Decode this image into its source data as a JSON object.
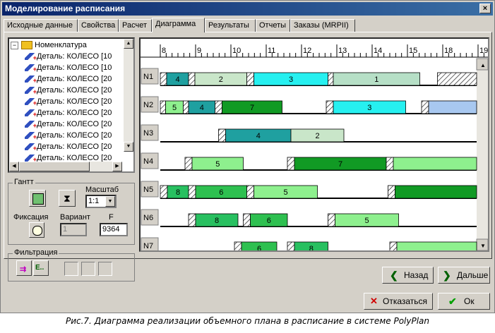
{
  "window": {
    "title": "Моделирование расписания",
    "close": "×"
  },
  "tabs": [
    {
      "label": "Исходные данные"
    },
    {
      "label": "Свойства"
    },
    {
      "label": "Расчет"
    },
    {
      "label": "Диаграмма"
    },
    {
      "label": "Результаты"
    },
    {
      "label": "Отчеты"
    },
    {
      "label": "Заказы (MRPII)"
    }
  ],
  "tree": {
    "root": "Номенклатура",
    "items": [
      "Деталь: КОЛЕСО [10",
      "Деталь: КОЛЕСО [10",
      "Деталь: КОЛЕСО [20",
      "Деталь: КОЛЕСО [20",
      "Деталь: КОЛЕСО [20",
      "Деталь: КОЛЕСО [20",
      "Деталь: КОЛЕСО [20",
      "Деталь: КОЛЕСО [20",
      "Деталь: КОЛЕСО [20",
      "Деталь: КОЛЕСО [20"
    ]
  },
  "gantt_group": {
    "title": "Гантт",
    "scale_label": "Масштаб",
    "scale_value": "1:1",
    "fix_label": "Фиксация",
    "variant_label": "Вариант",
    "variant_value": "1",
    "f_label": "F",
    "f_value": "9364"
  },
  "filter_group": {
    "title": "Фильтрация",
    "btn2_text": "E.."
  },
  "buttons": {
    "back": "Назад",
    "next": "Дальше",
    "cancel": "Отказаться",
    "ok": "Ок"
  },
  "caption": "Рис.7. Диаграмма реализации объемного плана в расписание в системе PolyPlan",
  "colors": {
    "c1": "#b6dfc6",
    "c2": "#c9e6c9",
    "c3": "#26f0f0",
    "c4": "#1fa0a0",
    "c5": "#8ef08e",
    "c6": "#2ec050",
    "c7": "#119a24",
    "c8": "#28c060",
    "blue": "#a8c8f0"
  },
  "chart_data": {
    "type": "gantt",
    "x_axis": {
      "ticks": [
        "8",
        "9",
        "10",
        "11",
        "12",
        "13",
        "14",
        "15",
        "18",
        "19"
      ]
    },
    "rows": [
      {
        "name": "N1",
        "bars": [
          {
            "start": 8.0,
            "end": 8.18,
            "label": "",
            "hatch": true
          },
          {
            "start": 8.18,
            "end": 8.8,
            "label": "4",
            "color": "c4"
          },
          {
            "start": 8.8,
            "end": 8.98,
            "label": "",
            "hatch": true
          },
          {
            "start": 8.98,
            "end": 10.45,
            "label": "2",
            "color": "c2"
          },
          {
            "start": 10.45,
            "end": 10.65,
            "label": "",
            "hatch": true
          },
          {
            "start": 10.65,
            "end": 12.75,
            "label": "3",
            "color": "c3"
          },
          {
            "start": 12.75,
            "end": 12.9,
            "label": "",
            "hatch": true
          },
          {
            "start": 12.9,
            "end": 15.35,
            "label": "1",
            "color": "c1"
          },
          {
            "start": 15.85,
            "end": 17.0,
            "label": "",
            "hatch": true
          }
        ]
      },
      {
        "name": "N2",
        "bars": [
          {
            "start": 8.0,
            "end": 8.15,
            "label": "",
            "hatch": true
          },
          {
            "start": 8.15,
            "end": 8.65,
            "label": "5",
            "color": "c5"
          },
          {
            "start": 8.65,
            "end": 8.8,
            "label": "",
            "hatch": true
          },
          {
            "start": 8.8,
            "end": 9.55,
            "label": "4",
            "color": "c4"
          },
          {
            "start": 9.55,
            "end": 9.75,
            "label": "",
            "hatch": true
          },
          {
            "start": 9.75,
            "end": 11.45,
            "label": "7",
            "color": "c7"
          },
          {
            "start": 12.7,
            "end": 12.9,
            "label": "",
            "hatch": true
          },
          {
            "start": 12.9,
            "end": 14.95,
            "label": "3",
            "color": "c3"
          },
          {
            "start": 15.4,
            "end": 15.6,
            "label": "",
            "hatch": true
          },
          {
            "start": 15.6,
            "end": 17.0,
            "label": "",
            "color": "blue"
          }
        ]
      },
      {
        "name": "N3",
        "bars": [
          {
            "start": 9.65,
            "end": 9.85,
            "label": "",
            "hatch": true
          },
          {
            "start": 9.85,
            "end": 11.7,
            "label": "4",
            "color": "c4"
          },
          {
            "start": 11.7,
            "end": 13.2,
            "label": "2",
            "color": "c2"
          }
        ]
      },
      {
        "name": "N4",
        "bars": [
          {
            "start": 8.7,
            "end": 8.9,
            "label": "",
            "hatch": true
          },
          {
            "start": 8.9,
            "end": 10.35,
            "label": "5",
            "color": "c5"
          },
          {
            "start": 11.6,
            "end": 11.8,
            "label": "",
            "hatch": true
          },
          {
            "start": 11.8,
            "end": 14.4,
            "label": "7",
            "color": "c7"
          },
          {
            "start": 14.4,
            "end": 14.6,
            "label": "",
            "hatch": true
          },
          {
            "start": 14.6,
            "end": 17.0,
            "label": "",
            "color": "c5"
          }
        ]
      },
      {
        "name": "N5",
        "bars": [
          {
            "start": 8.0,
            "end": 8.2,
            "label": "",
            "hatch": true
          },
          {
            "start": 8.2,
            "end": 8.8,
            "label": "8",
            "color": "c8"
          },
          {
            "start": 8.8,
            "end": 9.0,
            "label": "",
            "hatch": true
          },
          {
            "start": 9.0,
            "end": 10.45,
            "label": "6",
            "color": "c6"
          },
          {
            "start": 10.45,
            "end": 10.65,
            "label": "",
            "hatch": true
          },
          {
            "start": 10.65,
            "end": 12.45,
            "label": "5",
            "color": "c5"
          },
          {
            "start": 14.45,
            "end": 14.65,
            "label": "",
            "hatch": true
          },
          {
            "start": 14.65,
            "end": 17.0,
            "label": "",
            "color": "c7"
          }
        ]
      },
      {
        "name": "N6",
        "bars": [
          {
            "start": 8.8,
            "end": 9.0,
            "label": "",
            "hatch": true
          },
          {
            "start": 9.0,
            "end": 10.2,
            "label": "8",
            "color": "c8"
          },
          {
            "start": 10.35,
            "end": 10.55,
            "label": "",
            "hatch": true
          },
          {
            "start": 10.55,
            "end": 11.6,
            "label": "6",
            "color": "c6"
          },
          {
            "start": 12.75,
            "end": 12.95,
            "label": "",
            "hatch": true
          },
          {
            "start": 12.95,
            "end": 14.75,
            "label": "5",
            "color": "c5"
          }
        ]
      },
      {
        "name": "N7",
        "bars": [
          {
            "start": 10.1,
            "end": 10.3,
            "label": "",
            "hatch": true
          },
          {
            "start": 10.3,
            "end": 11.3,
            "label": "6",
            "color": "c6"
          },
          {
            "start": 11.6,
            "end": 11.8,
            "label": "",
            "hatch": true
          },
          {
            "start": 11.8,
            "end": 12.75,
            "label": "8",
            "color": "c8"
          },
          {
            "start": 14.5,
            "end": 14.7,
            "label": "",
            "hatch": true
          },
          {
            "start": 14.7,
            "end": 17.0,
            "label": "",
            "color": "c5"
          }
        ]
      }
    ]
  }
}
